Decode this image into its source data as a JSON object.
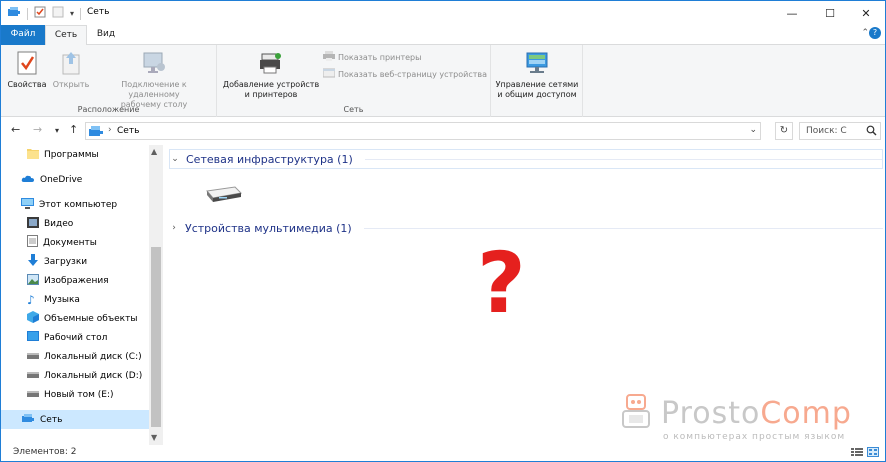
{
  "window": {
    "title": "Сеть",
    "minimize_glyph": "—",
    "maximize_glyph": "☐",
    "close_glyph": "✕"
  },
  "ribbon_tabs": [
    {
      "label": "Файл"
    },
    {
      "label": "Сеть"
    },
    {
      "label": "Вид"
    }
  ],
  "ribbon": {
    "groups": [
      {
        "label": "Расположение",
        "buttons": [
          {
            "label_line1": "Свойства",
            "label_line2": "",
            "enabled": true,
            "icon": "properties-checkmark-icon"
          },
          {
            "label_line1": "Открыть",
            "label_line2": "",
            "enabled": false,
            "icon": "open-arrow-icon"
          },
          {
            "label_line1": "Подключение к удаленному",
            "label_line2": "рабочему столу",
            "enabled": false,
            "icon": "remote-desktop-icon"
          }
        ]
      },
      {
        "label": "Сеть",
        "buttons": [
          {
            "label_line1": "Добавление устройств",
            "label_line2": "и принтеров",
            "enabled": true,
            "icon": "add-devices-printer-icon"
          }
        ],
        "small_buttons": [
          {
            "label": "Показать принтеры",
            "enabled": false,
            "icon": "printer-icon"
          },
          {
            "label": "Показать веб-страницу устройства",
            "enabled": false,
            "icon": "web-page-icon"
          }
        ]
      },
      {
        "label": "",
        "buttons": [
          {
            "label_line1": "Управление сетями",
            "label_line2": "и общим доступом",
            "enabled": true,
            "icon": "network-sharing-center-icon"
          }
        ]
      }
    ]
  },
  "address_bar": {
    "path": "Сеть",
    "search_placeholder": "Поиск: С"
  },
  "nav_pane": {
    "items": [
      {
        "label": "Программы",
        "icon": "folder-icon",
        "indent": 1,
        "selected": false
      },
      {
        "label": "OneDrive",
        "icon": "onedrive-cloud-icon",
        "indent": 0,
        "selected": false
      },
      {
        "label": "Этот компьютер",
        "icon": "computer-icon",
        "indent": 0,
        "selected": false
      },
      {
        "label": "Видео",
        "icon": "video-icon",
        "indent": 1,
        "selected": false
      },
      {
        "label": "Документы",
        "icon": "documents-icon",
        "indent": 1,
        "selected": false
      },
      {
        "label": "Загрузки",
        "icon": "downloads-icon",
        "indent": 1,
        "selected": false
      },
      {
        "label": "Изображения",
        "icon": "pictures-icon",
        "indent": 1,
        "selected": false
      },
      {
        "label": "Музыка",
        "icon": "music-icon",
        "indent": 1,
        "selected": false
      },
      {
        "label": "Объемные объекты",
        "icon": "3d-objects-icon",
        "indent": 1,
        "selected": false
      },
      {
        "label": "Рабочий стол",
        "icon": "desktop-icon",
        "indent": 1,
        "selected": false
      },
      {
        "label": "Локальный диск (C:)",
        "icon": "drive-icon",
        "indent": 1,
        "selected": false
      },
      {
        "label": "Локальный диск (D:)",
        "icon": "drive-icon",
        "indent": 1,
        "selected": false
      },
      {
        "label": "Новый том (E:)",
        "icon": "drive-icon",
        "indent": 1,
        "selected": false
      },
      {
        "label": "Сеть",
        "icon": "network-icon",
        "indent": 0,
        "selected": true
      }
    ]
  },
  "content": {
    "groups": [
      {
        "label": "Сетевая инфраструктура (1)",
        "expanded": true
      },
      {
        "label": "Устройства мультимедиа (1)",
        "expanded": false
      }
    ],
    "question_mark": "?",
    "watermark": {
      "brand_part1": "Prosto",
      "brand_part2": "Comp",
      "tagline": "о компьютерах простым языком"
    }
  },
  "status_bar": {
    "text": "Элементов: 2"
  },
  "colors": {
    "accent": "#1979ca",
    "question_mark": "#e5201e",
    "group_header": "#1e3287",
    "selection": "#cce8ff",
    "watermark_orange": "#f7a98f",
    "watermark_gray": "#c8c8c8"
  }
}
